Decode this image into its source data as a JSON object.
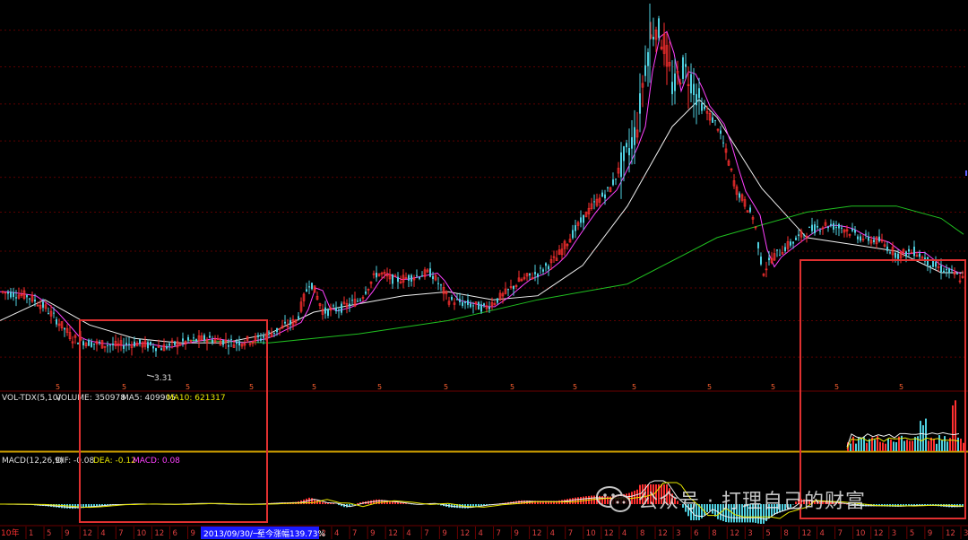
{
  "vol_header": {
    "name": "VOL-TDX(5,10)",
    "volume": "VOLUME: 350978",
    "ma5": "MA5: 409905",
    "ma10": "MA10: 621317"
  },
  "macd_header": {
    "name": "MACD(12,26,9)",
    "dif": "DIF: -0.08",
    "dea": "DEA: -0.12",
    "macd": "MACD: 0.08"
  },
  "price_low_label": "3.31",
  "date_bar": {
    "date": "2013/09/30/一",
    "change": "至今涨幅139.73%"
  },
  "x_left_label": "10年",
  "x_ticks": [
    "1",
    "5",
    "9",
    "12",
    "4",
    "7",
    "10",
    "12",
    "6",
    "9",
    "12",
    "4",
    "8",
    "12",
    "4",
    "8",
    "12",
    "4",
    "7",
    "9",
    "12",
    "4",
    "7",
    "9",
    "12",
    "4",
    "7",
    "9",
    "12",
    "4",
    "7",
    "10",
    "12",
    "4",
    "8",
    "12",
    "3",
    "6",
    "8",
    "12",
    "3",
    "5",
    "8",
    "12",
    "4",
    "7",
    "10",
    "12",
    "3",
    "5",
    "9",
    "12",
    "3"
  ],
  "event_marks": [
    "5",
    "5",
    "5",
    "5",
    "5",
    "5",
    "5",
    "5",
    "5",
    "5",
    "5",
    "5",
    "5",
    "5",
    "5"
  ],
  "watermark": "公众号 · 打理自己的财富",
  "colors": {
    "up": "#ff3030",
    "down": "#4fd0e0",
    "ma_white": "#f0f0f0",
    "ma_magenta": "#ff40ff",
    "ma_green": "#20c020",
    "ma_yellow": "#e8e800",
    "highlight_box": "#e03030",
    "grid": "#5a0000"
  },
  "chart_data": [
    {
      "type": "candlestick",
      "title": "",
      "low_annotation": 3.31,
      "series": [
        {
          "name": "",
          "x": [
            0,
            30,
            50,
            80,
            100,
            130,
            150,
            180,
            200,
            230,
            260,
            290,
            310,
            330,
            345,
            360,
            380,
            400,
            420,
            440,
            460,
            480,
            500,
            520,
            540,
            560,
            580,
            600,
            620,
            640,
            660,
            680,
            700,
            710,
            720,
            730,
            740,
            750,
            760,
            770,
            780,
            800,
            820,
            840,
            850,
            860,
            880,
            900,
            920,
            940,
            960,
            980,
            1000,
            1020,
            1040,
            1060,
            1075
          ],
          "close": [
            4.05,
            4.0,
            3.85,
            3.5,
            3.45,
            3.42,
            3.45,
            3.4,
            3.45,
            3.5,
            3.45,
            3.5,
            3.6,
            3.7,
            4.2,
            3.8,
            3.85,
            3.95,
            4.3,
            4.2,
            4.25,
            4.3,
            3.95,
            3.9,
            3.85,
            4.0,
            4.2,
            4.3,
            4.5,
            4.9,
            5.3,
            5.6,
            6.3,
            6.8,
            8.4,
            9.4,
            8.8,
            7.6,
            8.2,
            7.9,
            7.3,
            6.8,
            5.6,
            5.1,
            4.3,
            4.5,
            4.7,
            4.9,
            5.0,
            4.95,
            4.8,
            4.75,
            4.55,
            4.6,
            4.4,
            4.3,
            4.2
          ]
        }
      ]
    },
    {
      "type": "line",
      "title": "",
      "series": [
        {
          "name": "",
          "x": [
            0,
            50,
            100,
            150,
            200,
            250,
            300,
            350,
            400,
            450,
            500,
            550,
            600,
            650,
            700,
            750,
            780,
            800,
            850,
            900,
            950,
            1000,
            1050,
            1075
          ],
          "values": [
            3.7,
            3.95,
            3.65,
            3.5,
            3.45,
            3.45,
            3.55,
            3.8,
            3.9,
            4.0,
            4.05,
            3.95,
            4.0,
            4.4,
            5.3,
            6.8,
            7.4,
            7.0,
            5.6,
            4.8,
            4.7,
            4.6,
            4.3,
            4.3
          ]
        },
        {
          "name": "",
          "x": [
            210,
            300,
            400,
            500,
            600,
            700,
            800,
            900,
            950,
            1000,
            1050,
            1075
          ],
          "values": [
            3.48,
            3.45,
            3.55,
            3.7,
            3.95,
            4.15,
            4.8,
            5.2,
            5.3,
            5.3,
            5.1,
            4.85
          ]
        }
      ]
    },
    {
      "type": "bar",
      "title": "VOL-TDX(5,10)",
      "values_last": {
        "VOLUME": 350978,
        "MA5": 409905,
        "MA10": 621317
      },
      "visible_range_x": [
        945,
        1075
      ]
    },
    {
      "type": "line",
      "title": "MACD(12,26,9)",
      "values_last": {
        "DIF": -0.08,
        "DEA": -0.12,
        "MACD": 0.08
      }
    }
  ]
}
